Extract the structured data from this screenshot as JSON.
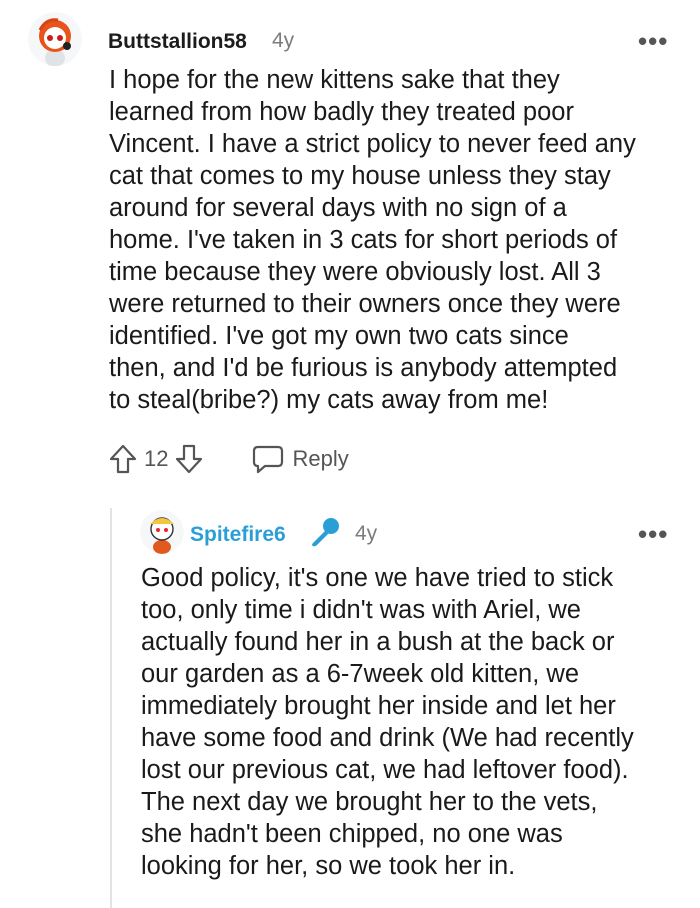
{
  "comment": {
    "username": "Buttstallion58",
    "age": "4y",
    "more": "•••",
    "text": "I hope for the new kittens sake that they learned from how badly they treated poor Vincent. I have a strict policy to never feed any cat that comes to my house unless they stay around for several days with no sign of a home. I've taken in 3 cats for short periods of time because they were obviously lost. All 3 were returned to their owners once they were identified. I've got my own two cats since then, and I'd be furious is anybody attempted to steal(bribe?) my cats away from me!",
    "lines": [
      "I hope for the new kittens sake that they",
      "learned from how badly they treated poor",
      "Vincent. I have a strict policy to never feed any",
      "cat that comes to my house unless they stay",
      "around for several days with no sign of a",
      "home. I've taken in 3 cats for short periods of",
      "time because they were obviously lost. All 3",
      "were returned to their owners once they were",
      "identified. I've got my own two cats since",
      "then, and I'd be furious is anybody attempted",
      "to steal(bribe?) my cats away from me!"
    ],
    "votes": "12",
    "reply_label": "Reply",
    "icons": {
      "upvote": "upvote-arrow-icon",
      "downvote": "downvote-arrow-icon",
      "reply": "speech-bubble-icon",
      "more": "more-options-icon"
    }
  },
  "reply": {
    "username": "Spitefire6",
    "age": "4y",
    "more": "•••",
    "badge_icon": "microphone-icon",
    "lines": [
      "Good policy, it's one we have tried to stick",
      "too, only time i didn't was with Ariel, we",
      "actually found her in a bush at the back or",
      "our garden as a 6-7week old kitten, we",
      "immediately brought her inside and let her",
      "have some food and drink (We had recently",
      "lost our previous cat, we had leftover food).",
      "The next day we brought her to the vets,",
      "she hadn't been chipped, no one was",
      "looking for her, so we took her in."
    ]
  },
  "colors": {
    "username_reply": "#2a9fd6",
    "meta_gray": "#7c7c7c",
    "thread_line": "#e3e3e3",
    "text": "#1a1a1b"
  }
}
